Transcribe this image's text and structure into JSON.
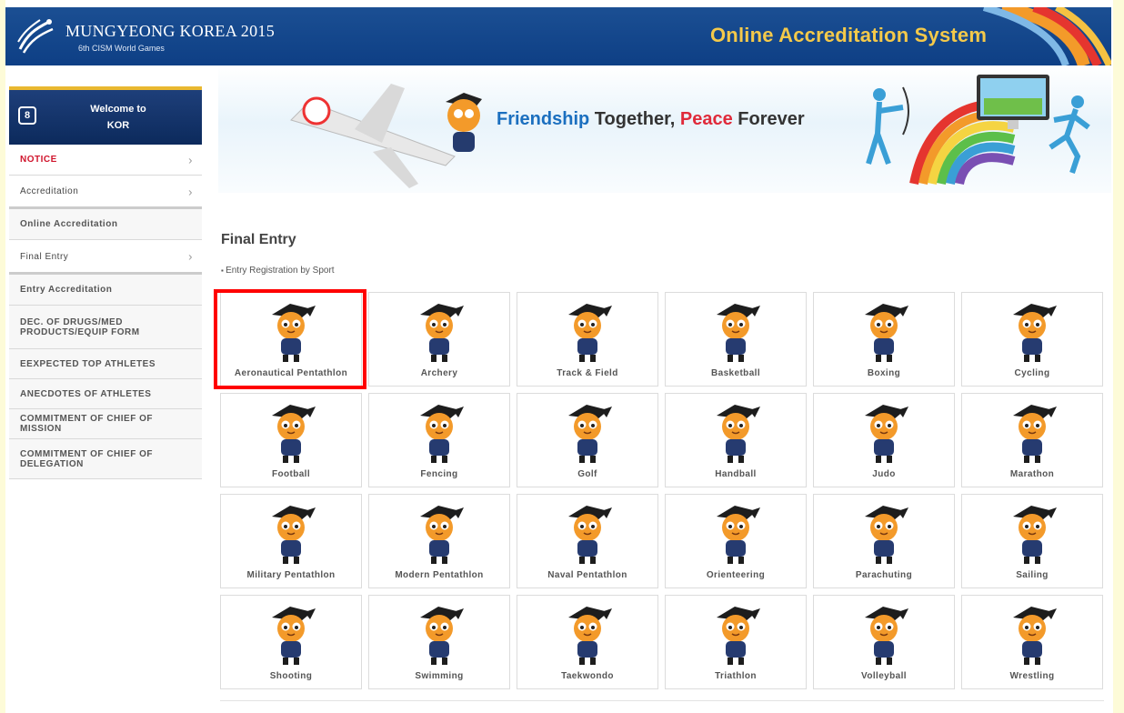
{
  "header": {
    "logo_title": "MUNGYEONG KOREA 2015",
    "logo_subtitle": "6th CISM World Games",
    "system_title": "Online Accreditation System"
  },
  "banner": {
    "slogan_part1": "Friendship ",
    "slogan_part2": "Together, ",
    "slogan_part3": "Peace",
    "slogan_part4": " Forever"
  },
  "sidebar": {
    "welcome_line1": "Welcome to",
    "welcome_line2": "KOR",
    "items": [
      {
        "label": "NOTICE",
        "chevron": "›"
      },
      {
        "label": "Accreditation",
        "chevron": "›"
      },
      {
        "label": "Online Accreditation",
        "chevron": ""
      },
      {
        "label": "Final Entry",
        "chevron": "›"
      },
      {
        "label": "Entry Accreditation",
        "chevron": ""
      },
      {
        "label": "DEC. OF DRUGS/MED PRODUCTS/EQUIP FORM",
        "chevron": ""
      },
      {
        "label": "EEXPECTED TOP ATHLETES",
        "chevron": ""
      },
      {
        "label": "ANECDOTES OF ATHLETES",
        "chevron": ""
      },
      {
        "label": "COMMITMENT OF CHIEF OF MISSION",
        "chevron": ""
      },
      {
        "label": "COMMITMENT OF CHIEF OF DELEGATION",
        "chevron": ""
      }
    ]
  },
  "main": {
    "title": "Final Entry",
    "subtitle": "Entry Registration by Sport",
    "sports": [
      {
        "label": "Aeronautical Pentathlon",
        "icon": "aeronautical-pentathlon-mascot-icon"
      },
      {
        "label": "Archery",
        "icon": "archery-mascot-icon"
      },
      {
        "label": "Track & Field",
        "icon": "track-field-mascot-icon"
      },
      {
        "label": "Basketball",
        "icon": "basketball-mascot-icon"
      },
      {
        "label": "Boxing",
        "icon": "boxing-mascot-icon"
      },
      {
        "label": "Cycling",
        "icon": "cycling-mascot-icon"
      },
      {
        "label": "Football",
        "icon": "football-mascot-icon"
      },
      {
        "label": "Fencing",
        "icon": "fencing-mascot-icon"
      },
      {
        "label": "Golf",
        "icon": "golf-mascot-icon"
      },
      {
        "label": "Handball",
        "icon": "handball-mascot-icon"
      },
      {
        "label": "Judo",
        "icon": "judo-mascot-icon"
      },
      {
        "label": "Marathon",
        "icon": "marathon-mascot-icon"
      },
      {
        "label": "Military Pentathlon",
        "icon": "military-pentathlon-mascot-icon"
      },
      {
        "label": "Modern Pentathlon",
        "icon": "modern-pentathlon-mascot-icon"
      },
      {
        "label": "Naval Pentathlon",
        "icon": "naval-pentathlon-mascot-icon"
      },
      {
        "label": "Orienteering",
        "icon": "orienteering-mascot-icon"
      },
      {
        "label": "Parachuting",
        "icon": "parachuting-mascot-icon"
      },
      {
        "label": "Sailing",
        "icon": "sailing-mascot-icon"
      },
      {
        "label": "Shooting",
        "icon": "shooting-mascot-icon"
      },
      {
        "label": "Swimming",
        "icon": "swimming-mascot-icon"
      },
      {
        "label": "Taekwondo",
        "icon": "taekwondo-mascot-icon"
      },
      {
        "label": "Triathlon",
        "icon": "triathlon-mascot-icon"
      },
      {
        "label": "Volleyball",
        "icon": "volleyball-mascot-icon"
      },
      {
        "label": "Wrestling",
        "icon": "wrestling-mascot-icon"
      }
    ]
  },
  "colors": {
    "header_bg": "#0e3f85",
    "header_title": "#f4c94a",
    "notice_red": "#d0142c",
    "highlight_red": "#ff0000",
    "mascot_orange": "#f39a2a"
  }
}
